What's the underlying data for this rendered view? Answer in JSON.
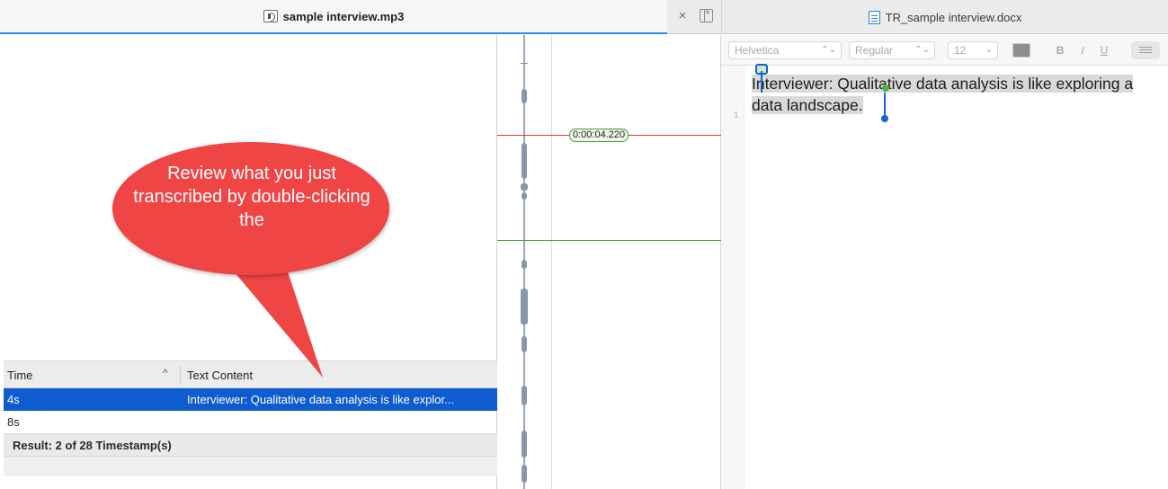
{
  "tabs": {
    "left_title": "sample interview.mp3",
    "right_title": "TR_sample interview.docx",
    "close_symbol": "×"
  },
  "callout": {
    "text": "Review what you just transcribed by double-clicking the",
    "color": "#f04545"
  },
  "table": {
    "col_time": "Time",
    "sort_indicator": "^",
    "col_text": "Text Content",
    "rows": [
      {
        "time": "4s",
        "text": "Interviewer: Qualitative data analysis is like explor...",
        "selected": true
      },
      {
        "time": "8s",
        "text": "",
        "selected": false
      }
    ],
    "footer": "Result: 2 of 28 Timestamp(s)",
    "selection_color": "#0e5ccf"
  },
  "waveform": {
    "playhead_time": "0:00:04.220",
    "playhead_color": "#e23b3b",
    "marker_color": "#3aa83a"
  },
  "toolbar": {
    "font": "Helvetica",
    "style": "Regular",
    "size": "12",
    "bold": "B",
    "italic": "I",
    "underline": "U"
  },
  "document": {
    "line_number": "1",
    "text": "Interviewer: Qualitative data analysis is like exploring a data landscape.",
    "cursor_color": "#1462d2"
  }
}
